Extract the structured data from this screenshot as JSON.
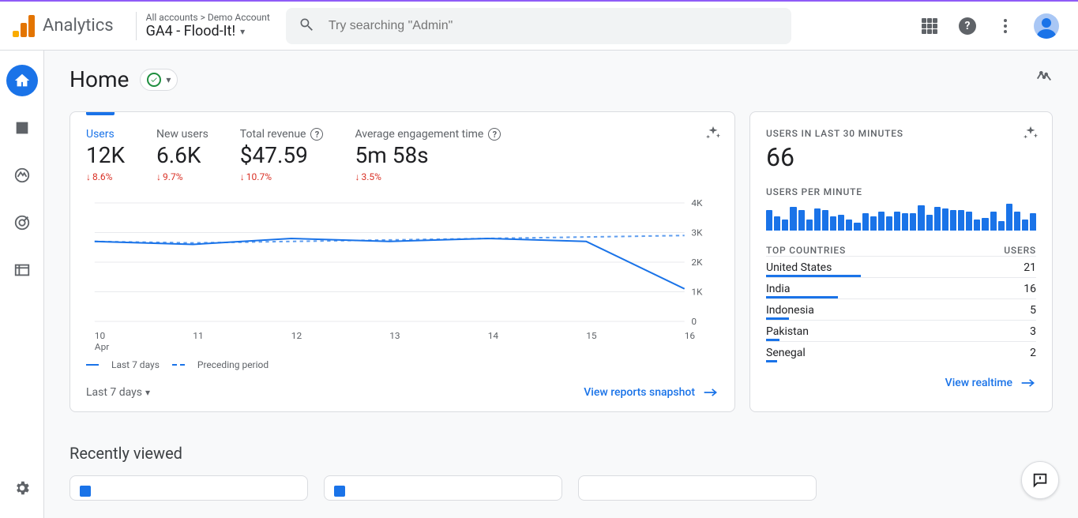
{
  "header": {
    "product": "Analytics",
    "breadcrumb": "All accounts > Demo Account",
    "property": "GA4 - Flood-It!",
    "search_placeholder": "Try searching \"Admin\""
  },
  "page": {
    "title": "Home"
  },
  "main_card": {
    "metrics": [
      {
        "label": "Users",
        "value": "12K",
        "delta": "8.6%"
      },
      {
        "label": "New users",
        "value": "6.6K",
        "delta": "9.7%"
      },
      {
        "label": "Total revenue",
        "value": "$47.59",
        "delta": "10.7%",
        "tooltip": true
      },
      {
        "label": "Average engagement time",
        "value": "5m 58s",
        "delta": "3.5%",
        "tooltip": true
      }
    ],
    "legend_solid": "Last 7 days",
    "legend_dashed": "Preceding period",
    "range_label": "Last 7 days",
    "link": "View reports snapshot",
    "x_sub": "Apr"
  },
  "realtime_card": {
    "label": "USERS IN LAST 30 MINUTES",
    "value": "66",
    "sub": "USERS PER MINUTE",
    "table_head_left": "TOP COUNTRIES",
    "table_head_right": "USERS",
    "rows": [
      {
        "name": "United States",
        "val": "21"
      },
      {
        "name": "India",
        "val": "16"
      },
      {
        "name": "Indonesia",
        "val": "5"
      },
      {
        "name": "Pakistan",
        "val": "3"
      },
      {
        "name": "Senegal",
        "val": "2"
      }
    ],
    "link": "View realtime"
  },
  "recent": {
    "title": "Recently viewed"
  },
  "chart_data": {
    "type": "line",
    "x": [
      "10",
      "11",
      "12",
      "13",
      "14",
      "15",
      "16"
    ],
    "x_sub": "Apr",
    "y_ticks": [
      "0",
      "1K",
      "2K",
      "3K",
      "4K"
    ],
    "ylim": [
      0,
      4000
    ],
    "series": [
      {
        "name": "Last 7 days",
        "style": "solid",
        "values": [
          2700,
          2600,
          2800,
          2700,
          2800,
          2700,
          1100
        ]
      },
      {
        "name": "Preceding period",
        "style": "dashed",
        "values": [
          2700,
          2650,
          2700,
          2750,
          2800,
          2850,
          2900
        ]
      }
    ],
    "mini_bars": [
      26,
      18,
      14,
      30,
      26,
      14,
      28,
      26,
      18,
      20,
      14,
      10,
      22,
      18,
      24,
      18,
      24,
      22,
      22,
      32,
      20,
      30,
      28,
      26,
      26,
      24,
      14,
      16,
      24,
      12,
      34,
      24,
      14,
      22
    ]
  }
}
